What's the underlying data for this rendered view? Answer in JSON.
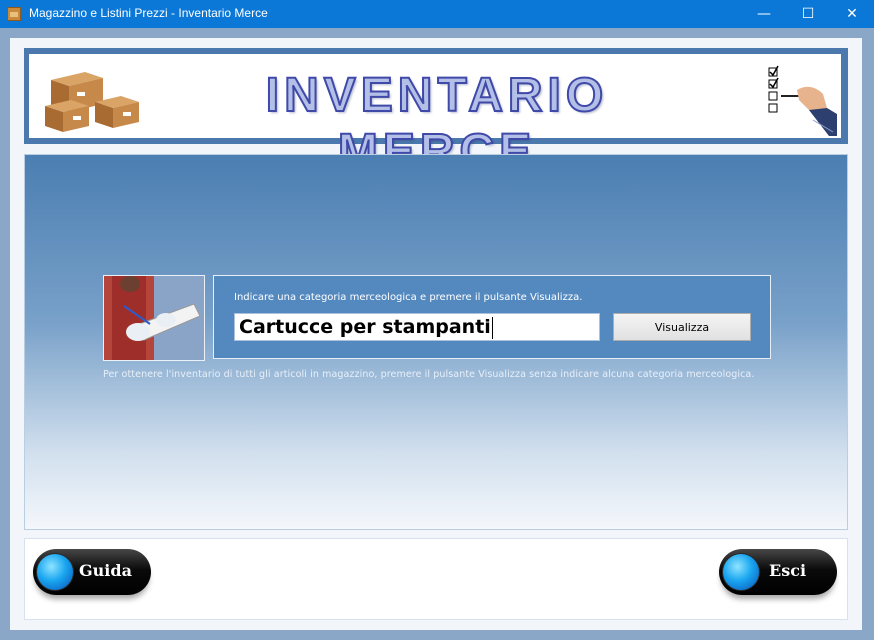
{
  "window": {
    "title": "Magazzino e Listini Prezzi - Inventario Merce",
    "minimize": "—",
    "maximize": "☐",
    "close": "✕"
  },
  "banner": {
    "title": "INVENTARIO MERCE"
  },
  "form": {
    "instruction": "Indicare una categoria merceologica e premere il pulsante Visualizza.",
    "category_value": "Cartucce per stampanti",
    "view_button": "Visualizza"
  },
  "hint": "Per ottenere l'inventario di tutti gli articoli in magazzino, premere il pulsante Visualizza senza indicare alcuna categoria merceologica.",
  "footer": {
    "help_button": "Guida",
    "exit_button": "Esci"
  },
  "colors": {
    "titlebar": "#0b78d7",
    "accent": "#4b79ad",
    "orb": "#1aa6f0"
  }
}
